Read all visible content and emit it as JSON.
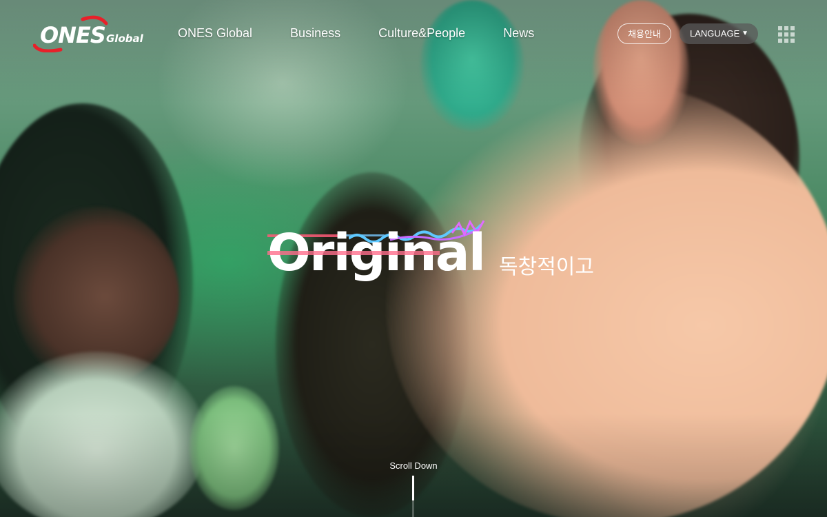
{
  "header": {
    "logo_main": "ONES",
    "logo_sub": "Global",
    "nav": [
      {
        "label": "ONES Global"
      },
      {
        "label": "Business"
      },
      {
        "label": "Culture&People"
      },
      {
        "label": "News"
      }
    ],
    "recruit_label": "채용안내",
    "language_label": "LANGUAGE",
    "language_caret": "▼"
  },
  "hero": {
    "headline": "Original",
    "headline_ko": "독창적이고"
  },
  "scroll": {
    "label": "Scroll Down",
    "progress": 0.6
  },
  "colors": {
    "brand_red": "#e8202a",
    "text": "#ffffff"
  },
  "icons": {
    "menu": "grid-menu-icon",
    "language": "caret-down-icon"
  }
}
